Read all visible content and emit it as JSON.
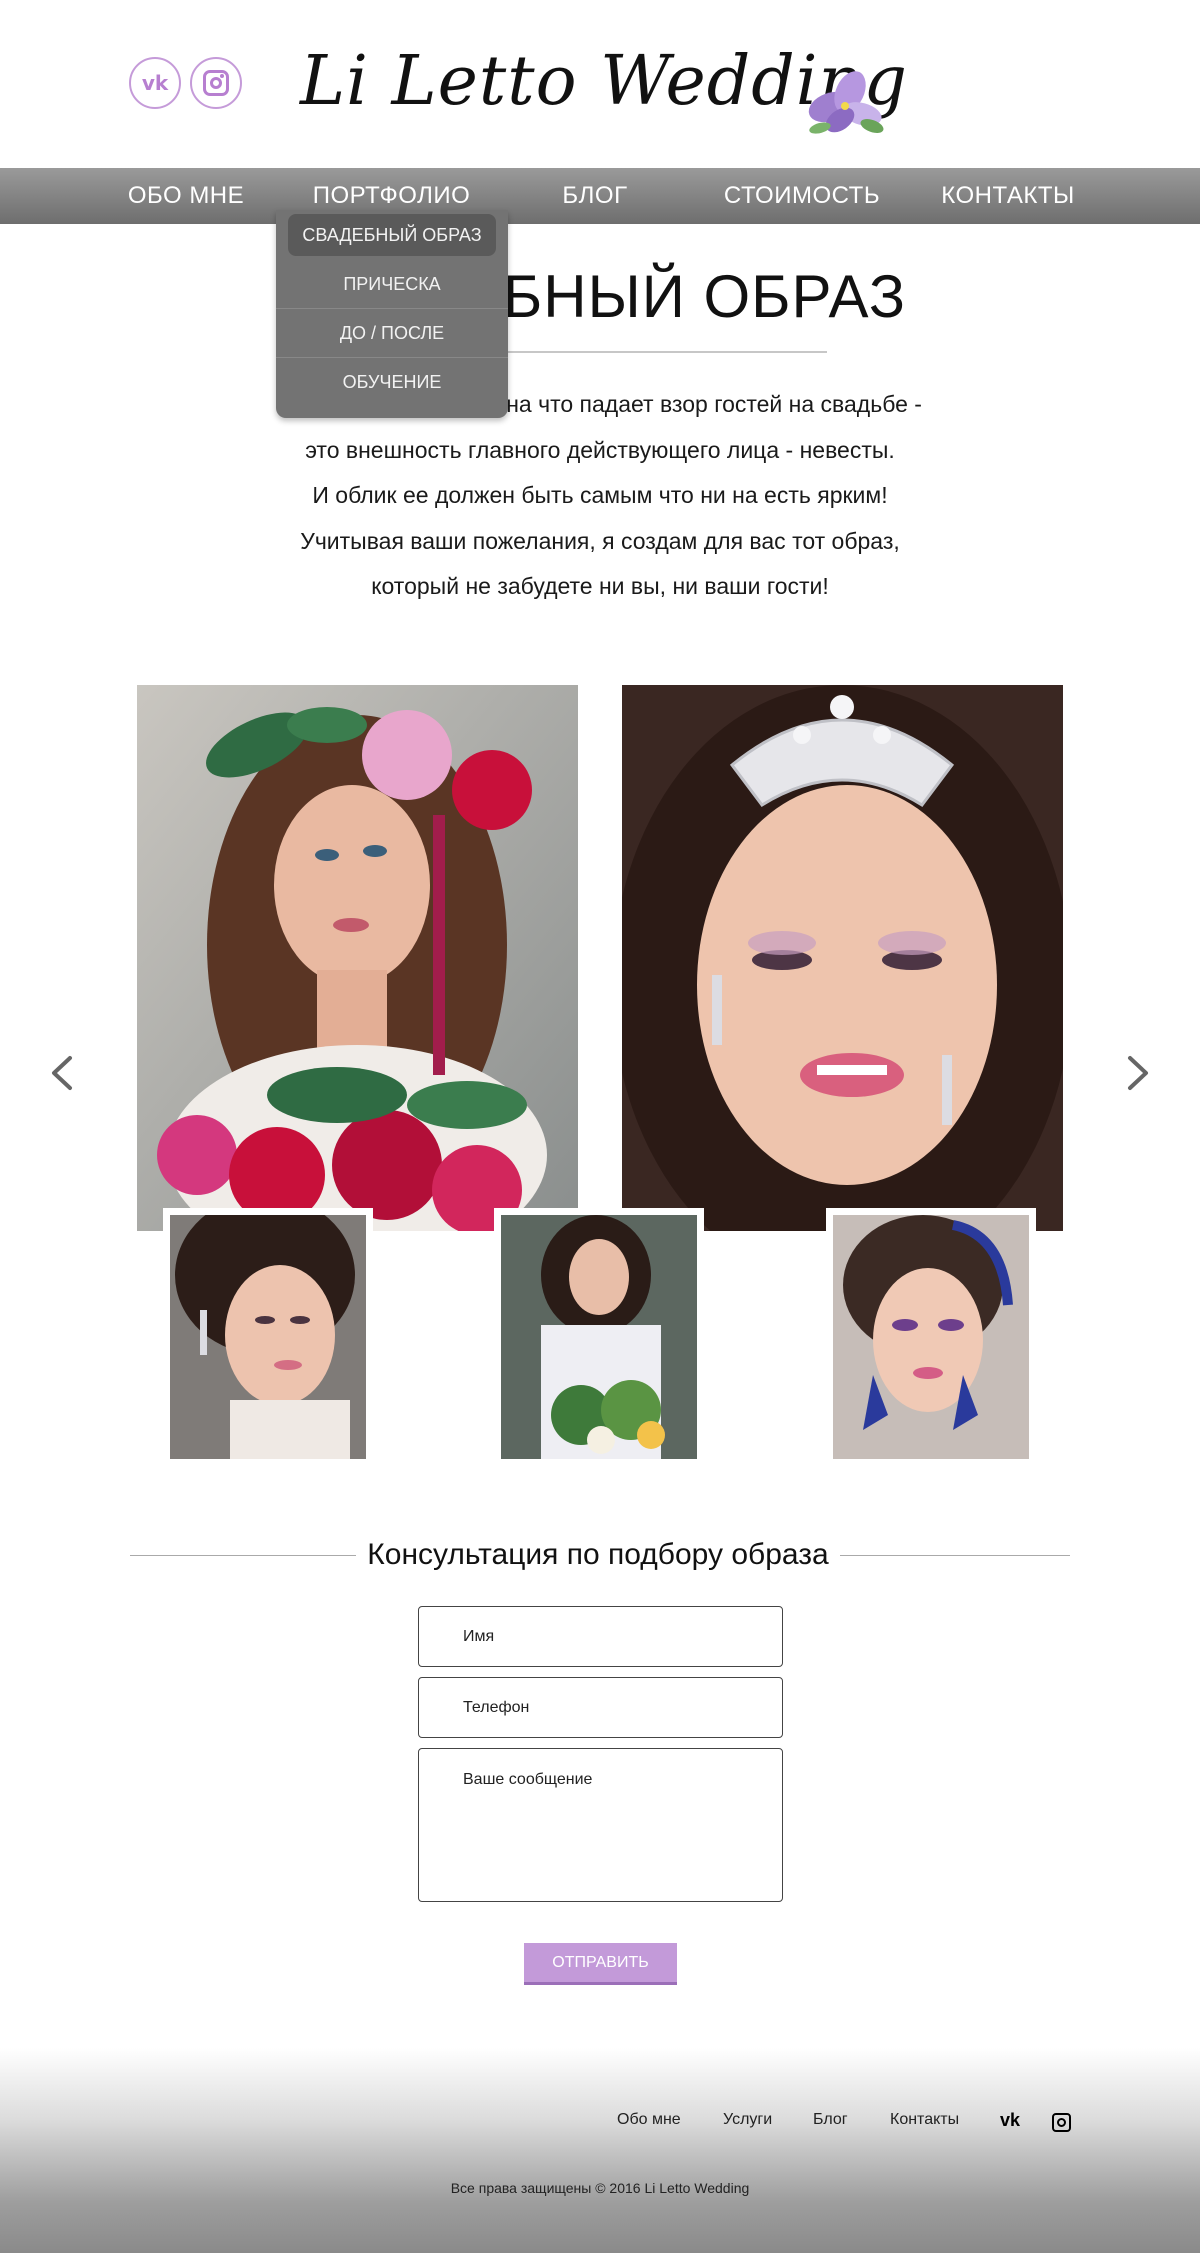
{
  "header": {
    "social": [
      {
        "name": "vk",
        "icon": "vk-icon",
        "glyph": "vk"
      },
      {
        "name": "instagram",
        "icon": "instagram-icon"
      }
    ],
    "logo_text": "Li Letto Wedding"
  },
  "nav": {
    "items": [
      "ОБО МНЕ",
      "ПОРТФОЛИО",
      "БЛОГ",
      "СТОИМОСТЬ",
      "КОНТАКТЫ"
    ]
  },
  "dropdown": {
    "items": [
      "СВАДЕБНЫЙ ОБРАЗ",
      "ПРИЧЕСКА",
      "ДО / ПОСЛЕ",
      "ОБУЧЕНИЕ"
    ],
    "active_index": 0
  },
  "intro": {
    "title": "СВАДЕБНЫЙ ОБРАЗ",
    "lines": [
      "Несомненно первое, на что падает взор гостей на свадьбе -",
      "это внешность главного действующего лица - невесты.",
      "И облик ее должен быть самым что ни на есть ярким!",
      "Учитывая ваши пожелания, я создам для вас тот образ,",
      "который не забудете ни вы, ни ваши гости!"
    ]
  },
  "gallery": {
    "arrows": [
      "chevron-left-icon",
      "chevron-right-icon"
    ]
  },
  "form": {
    "title": "Консультация по подбору образа",
    "name_placeholder": "Имя",
    "phone_placeholder": "Телефон",
    "message_placeholder": "Ваше сообщение",
    "submit_label": "ОТПРАВИТЬ"
  },
  "footer": {
    "links": [
      "Обо мне",
      "Услуги",
      "Блог",
      "Контакты"
    ],
    "vk_glyph": "vk",
    "copyright": "Все права защищены © 2016 Li Letto Wedding"
  },
  "colors": {
    "accent": "#c39ad9",
    "nav_bg": "#8a8a8a",
    "dropdown_bg": "#737373"
  }
}
